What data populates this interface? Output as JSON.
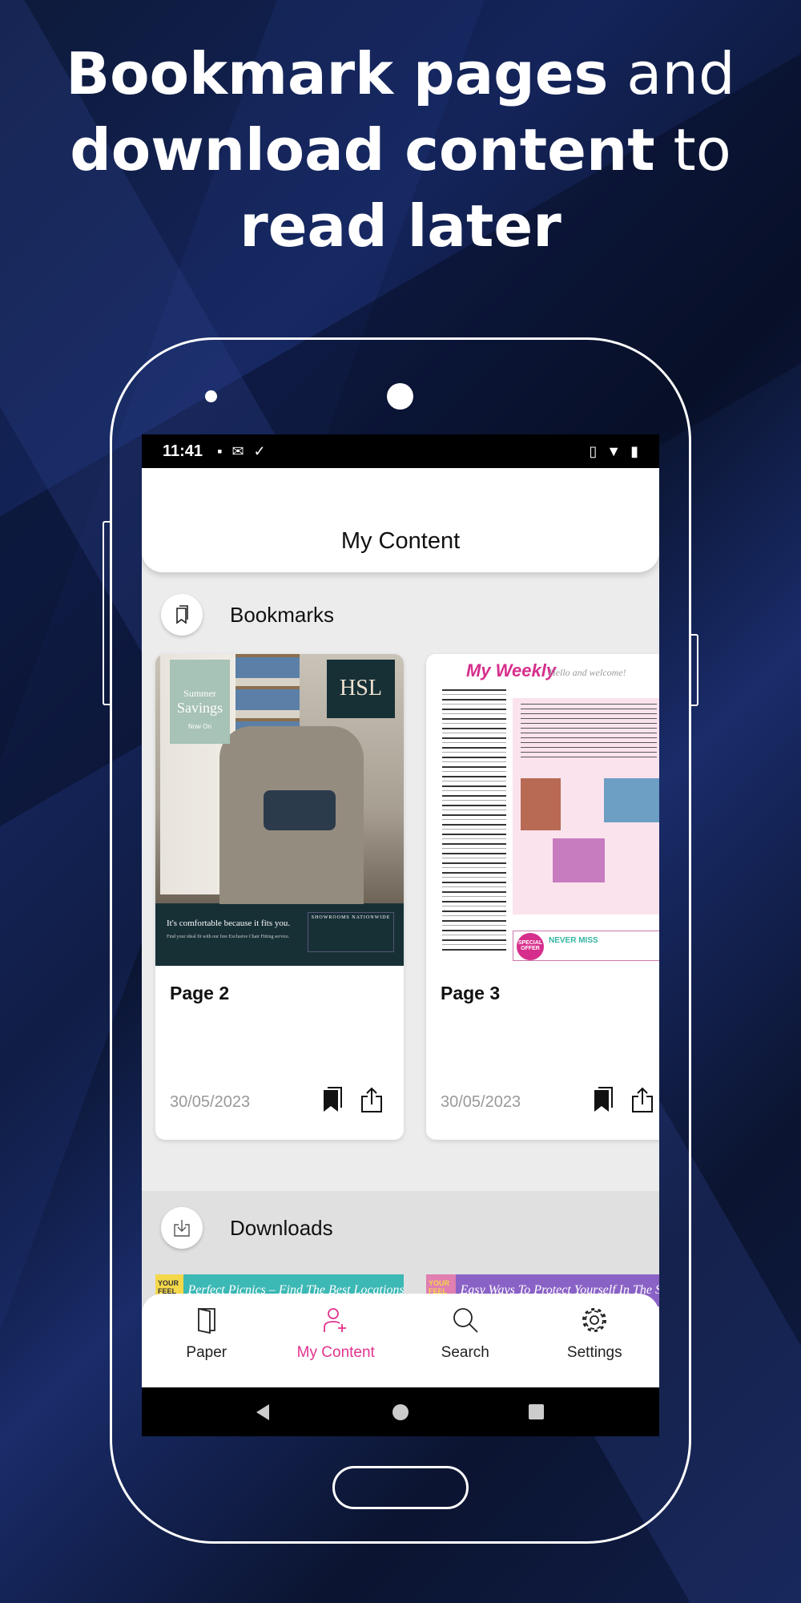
{
  "headline": {
    "bold1": "Bookmark pages",
    "normal1": "and",
    "bold2": "download content",
    "normal2": "to",
    "bold3": "read later"
  },
  "status": {
    "time": "11:41"
  },
  "header": {
    "title": "My Content"
  },
  "bookmarks": {
    "label": "Bookmarks",
    "items": [
      {
        "title": "Page 2",
        "date": "30/05/2023",
        "thumb": {
          "promo_small": "Summer",
          "promo_big": "Savings",
          "promo_sub": "Now On",
          "brand": "HSL",
          "tagline": "It's comfortable because it fits you.",
          "subline": "Find your ideal fit with our free Exclusive Chair Fitting service.",
          "box_title": "SHOWROOMS NATIONWIDE"
        }
      },
      {
        "title": "Page 3",
        "date": "30/05/2023",
        "thumb": {
          "brand": "My Weekly",
          "greeting": "Hello and welcome!",
          "offer": "SPECIAL OFFER",
          "never_miss": "NEVER MISS"
        }
      }
    ]
  },
  "downloads": {
    "label": "Downloads",
    "items": [
      {
        "tag": "YOUR FEEL GOOD READ!",
        "headline": "Perfect Picnics – Find The Best Locations!"
      },
      {
        "tag": "YOUR FEEL GOOD READ!",
        "headline": "Easy Ways To Protect Yourself In The Sun"
      }
    ]
  },
  "nav": {
    "items": [
      {
        "label": "Paper",
        "icon": "book-icon"
      },
      {
        "label": "My Content",
        "icon": "person-add-icon",
        "active": true
      },
      {
        "label": "Search",
        "icon": "search-icon"
      },
      {
        "label": "Settings",
        "icon": "gear-icon"
      }
    ]
  },
  "colors": {
    "accent": "#e0338e",
    "background": "#0d1a3a"
  }
}
